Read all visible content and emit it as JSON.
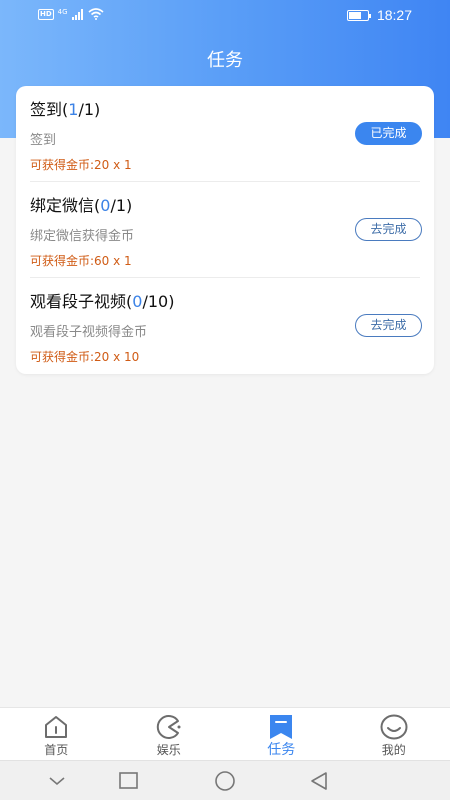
{
  "status_bar": {
    "hd": "HD",
    "network": "4G",
    "time": "18:27"
  },
  "header": {
    "title": "任务"
  },
  "tasks": [
    {
      "title": "签到",
      "progress_open": "(",
      "progress_done": "1",
      "progress_total": "/1)",
      "description": "签到",
      "reward": "可获得金币:20 x 1",
      "button_label": "已完成",
      "completed": true
    },
    {
      "title": "绑定微信",
      "progress_open": "(",
      "progress_done": "0",
      "progress_total": "/1)",
      "description": "绑定微信获得金币",
      "reward": "可获得金币:60 x 1",
      "button_label": "去完成",
      "completed": false
    },
    {
      "title": "观看段子视频",
      "progress_open": "(",
      "progress_done": "0",
      "progress_total": "/10)",
      "description": "观看段子视频得金币",
      "reward": "可获得金币:20 x 10",
      "button_label": "去完成",
      "completed": false
    }
  ],
  "tabbar": {
    "items": [
      {
        "label": "首页",
        "icon": "home-icon",
        "active": false
      },
      {
        "label": "娱乐",
        "icon": "pacman-icon",
        "active": false
      },
      {
        "label": "任务",
        "icon": "bookmark-icon",
        "active": true
      },
      {
        "label": "我的",
        "icon": "smiley-icon",
        "active": false
      }
    ]
  },
  "nav_bar": {
    "icons": [
      "chevron-down-icon",
      "recents-square-icon",
      "home-circle-icon",
      "back-triangle-icon"
    ]
  },
  "colors": {
    "header_gradient_start": "#7bb7fb",
    "header_gradient_end": "#3f85f3",
    "accent": "#3b86ef",
    "reward": "#d05c16"
  }
}
